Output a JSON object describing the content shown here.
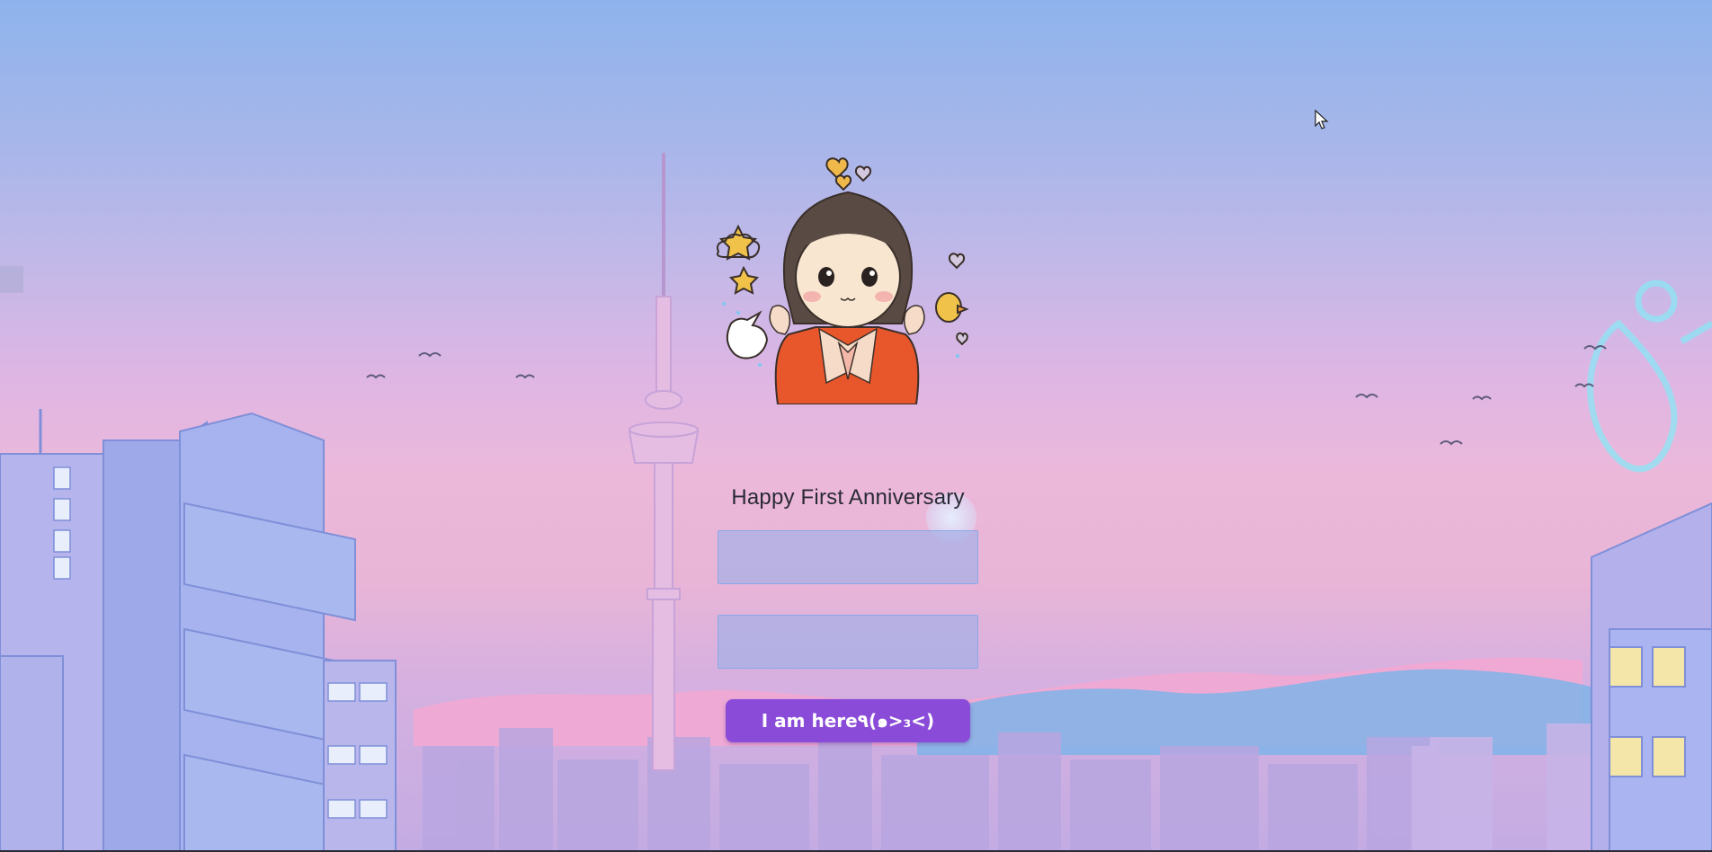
{
  "page": {
    "greeting": "Happy First Anniversary",
    "inputs": {
      "first_value": "",
      "second_value": ""
    },
    "button_label": "I am here٩(๑>₃<)"
  },
  "colors": {
    "sky_top": "#8eb3ec",
    "sky_mid": "#deb6e4",
    "button": "#8b4bd9",
    "input_fill": "#a6b0e6",
    "input_border": "#8aa8e6"
  },
  "icons": [
    "girl-avatar-icon",
    "star-icon",
    "heart-icon",
    "duck-icon",
    "unicorn-icon",
    "mouse-cursor-icon"
  ]
}
